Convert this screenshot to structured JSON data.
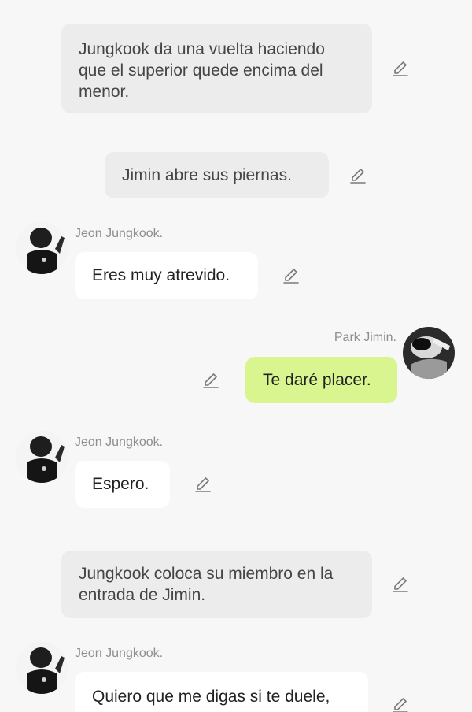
{
  "messages": [
    {
      "type": "narration",
      "text": "Jungkook da una vuelta haciendo que el superior quede encima del menor."
    },
    {
      "type": "narration",
      "text": "Jimin abre sus piernas."
    },
    {
      "type": "incoming",
      "sender": "Jeon Jungkook.",
      "text": "Eres muy atrevido."
    },
    {
      "type": "outgoing",
      "sender": "Park Jimin.",
      "text": "Te daré placer."
    },
    {
      "type": "incoming",
      "sender": "Jeon Jungkook.",
      "text": "Espero."
    },
    {
      "type": "narration",
      "text": "Jungkook coloca su miembro en la entrada de Jimin."
    },
    {
      "type": "incoming",
      "sender": "Jeon Jungkook.",
      "text": "Quiero que me digas si te duele,"
    }
  ],
  "icons": {
    "edit": "pencil-edit-icon",
    "avatar_jungkook": "avatar-photo-jungkook",
    "avatar_jimin": "avatar-photo-jimin"
  },
  "colors": {
    "background": "#f7f7f7",
    "narration_bubble": "#ececec",
    "incoming_bubble": "#ffffff",
    "outgoing_bubble": "#d8f58f",
    "sender_name": "#8e8e8e"
  }
}
